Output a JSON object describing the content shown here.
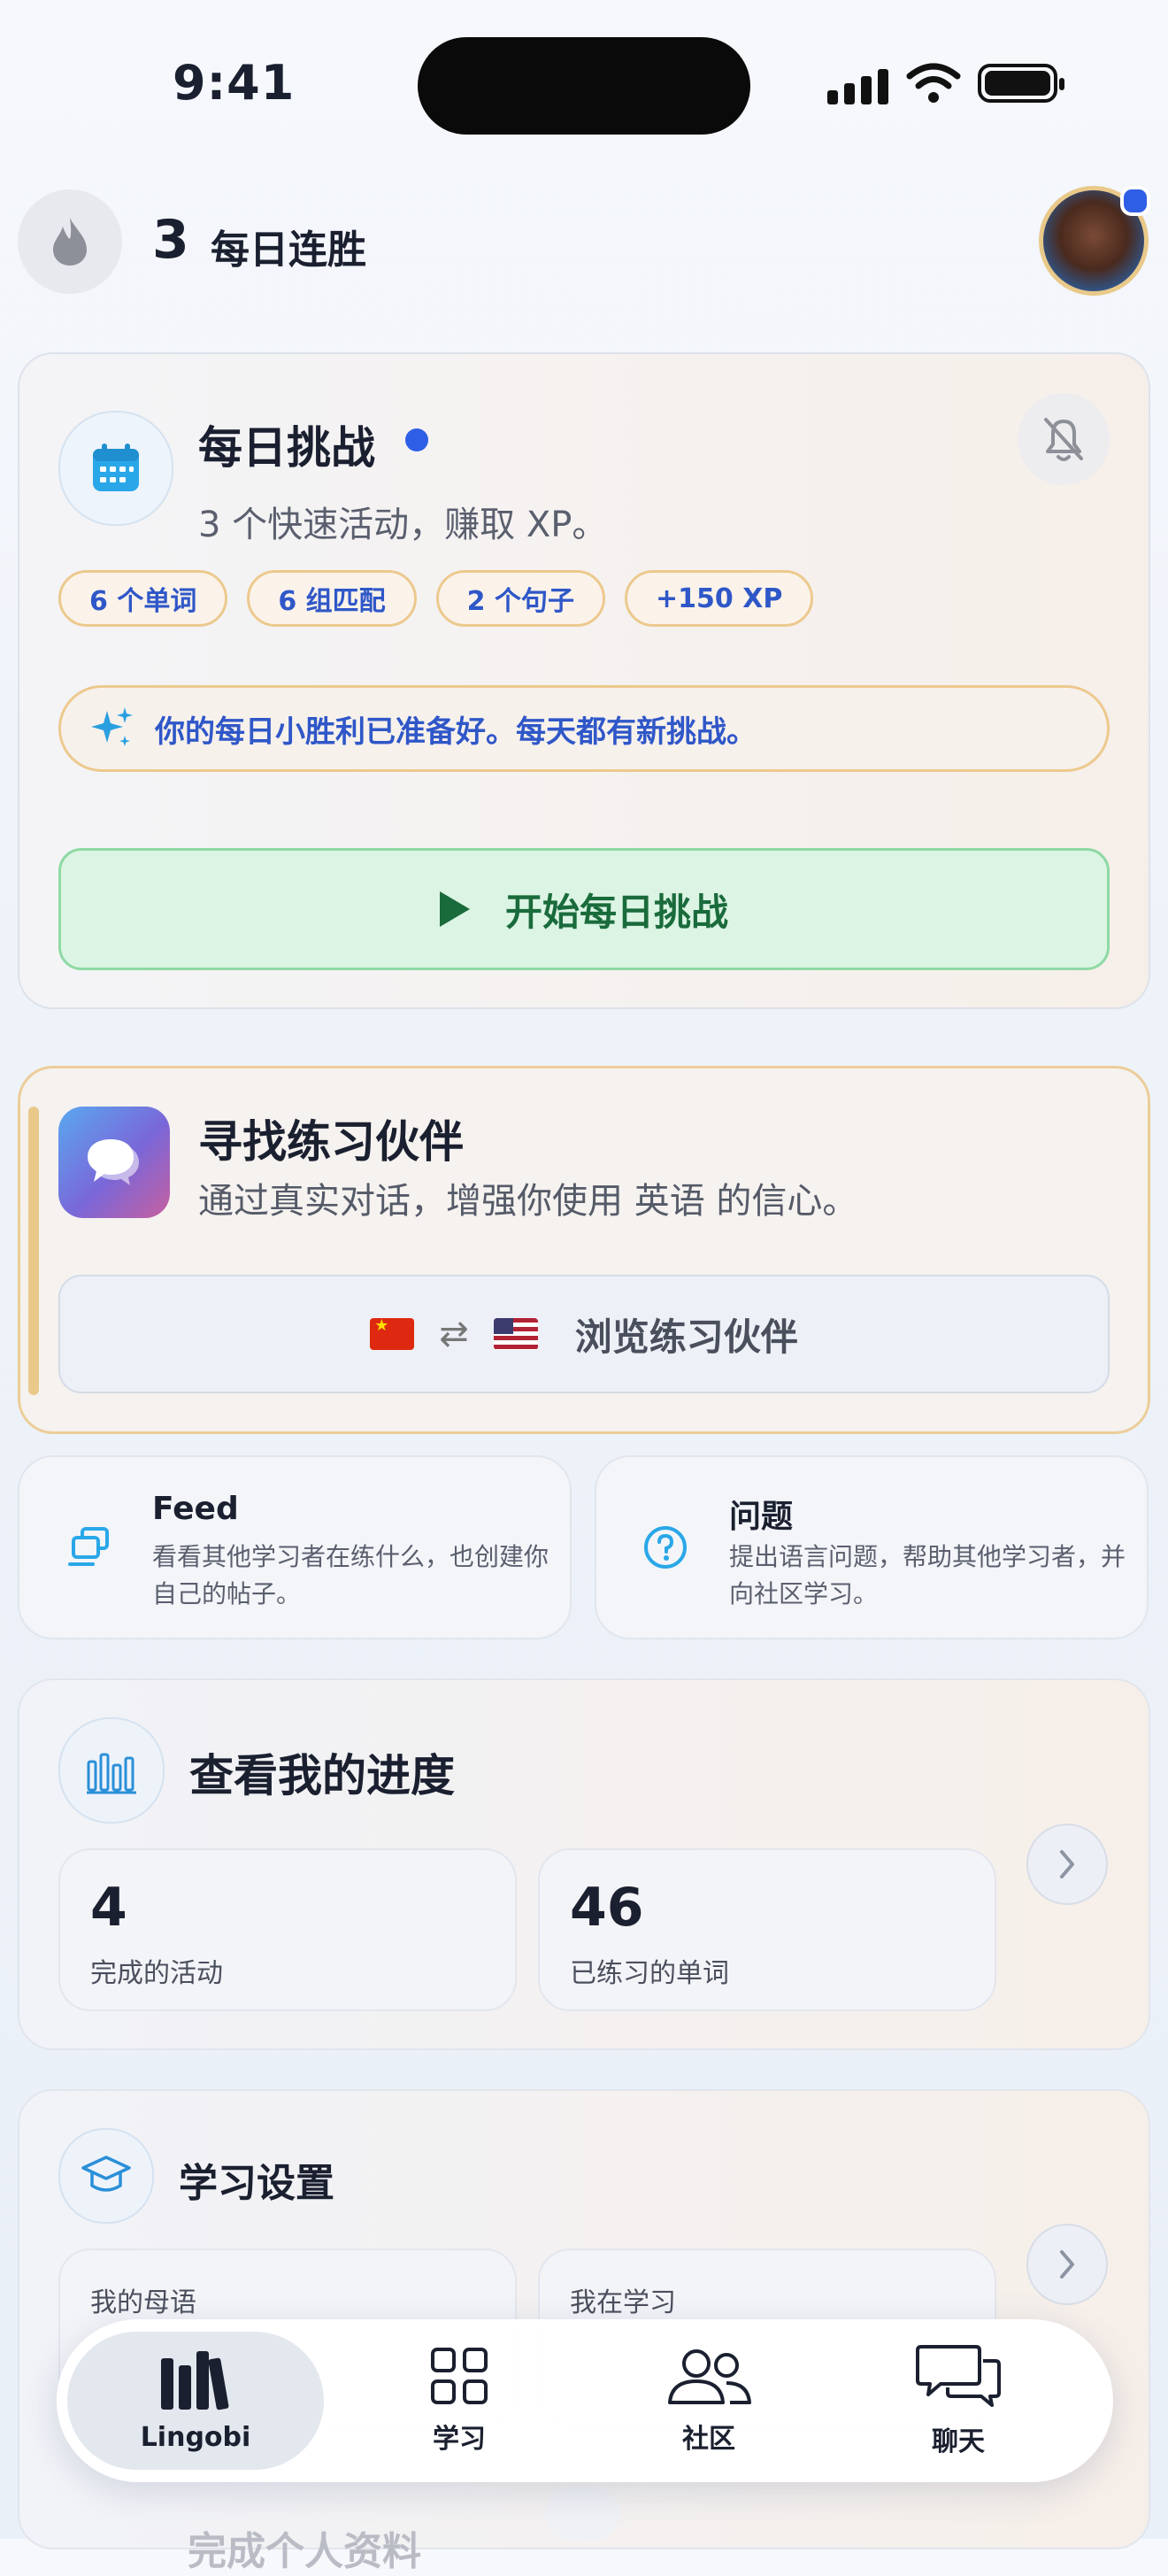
{
  "status_bar": {
    "time": "9:41"
  },
  "header": {
    "streak_count": "3",
    "streak_label": "每日连胜"
  },
  "daily_challenge": {
    "title": "每日挑战",
    "subtitle": "3 个快速活动，赚取 XP。",
    "chips": [
      "6 个单词",
      "6 组匹配",
      "2 个句子",
      "+150 XP"
    ],
    "banner": "你的每日小胜利已准备好。每天都有新挑战。",
    "start_button": "开始每日挑战"
  },
  "partner": {
    "title": "寻找练习伙伴",
    "subtitle": "通过真实对话，增强你使用 英语 的信心。",
    "browse_button": "浏览练习伙伴",
    "swap_symbol": "⇄"
  },
  "feed": {
    "title": "Feed",
    "desc": "看看其他学习者在练什么，也创建你自己的帖子。"
  },
  "questions": {
    "title": "问题",
    "desc": "提出语言问题，帮助其他学习者，并向社区学习。"
  },
  "progress": {
    "title": "查看我的进度",
    "stats": [
      {
        "value": "4",
        "label": "完成的活动"
      },
      {
        "value": "46",
        "label": "已练习的单词"
      }
    ]
  },
  "settings": {
    "title": "学习设置",
    "native_label": "我的母语",
    "learning_label": "我在学习"
  },
  "below_fold_text": "完成个人资料",
  "tabs": [
    {
      "label": "Lingobi"
    },
    {
      "label": "学习"
    },
    {
      "label": "社区"
    },
    {
      "label": "聊天"
    }
  ],
  "colors": {
    "accent_blue": "#2f5ee6",
    "gold_border": "#ecc98e",
    "green": "#1a6b3c"
  }
}
